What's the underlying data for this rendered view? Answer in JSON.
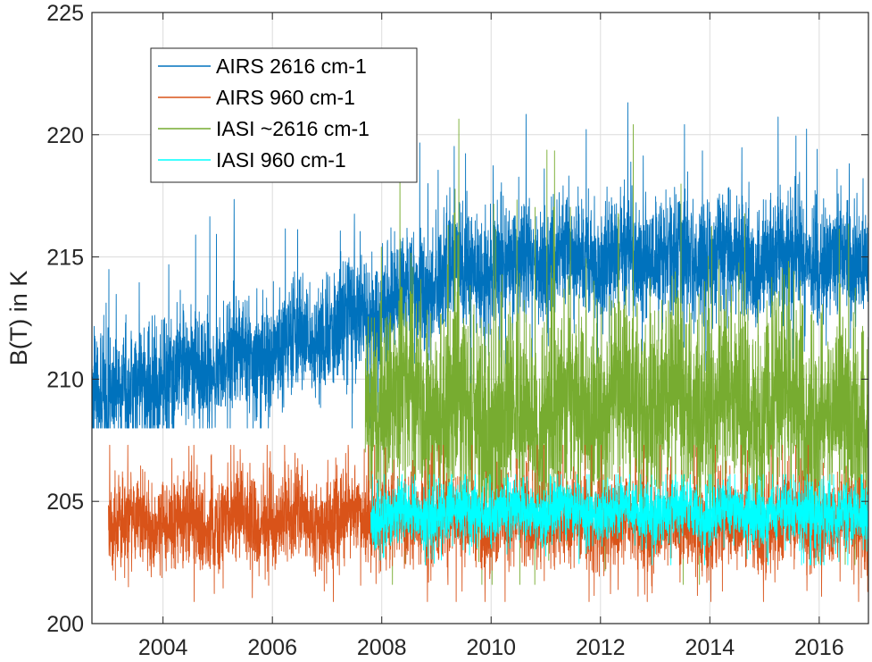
{
  "chart_data": {
    "type": "line",
    "title": "",
    "xlabel": "",
    "ylabel": "B(T) in K",
    "xlim": [
      2002.7,
      2016.9
    ],
    "ylim": [
      200,
      225
    ],
    "grid": true,
    "legend_position": "top-left",
    "x_ticks": [
      {
        "value": 2004,
        "label": "2004"
      },
      {
        "value": 2006,
        "label": "2006"
      },
      {
        "value": 2008,
        "label": "2008"
      },
      {
        "value": 2010,
        "label": "2010"
      },
      {
        "value": 2012,
        "label": "2012"
      },
      {
        "value": 2014,
        "label": "2014"
      },
      {
        "value": 2016,
        "label": "2016"
      }
    ],
    "y_ticks": [
      {
        "value": 200,
        "label": "200"
      },
      {
        "value": 205,
        "label": "205"
      },
      {
        "value": 210,
        "label": "210"
      },
      {
        "value": 215,
        "label": "215"
      },
      {
        "value": 220,
        "label": "220"
      },
      {
        "value": 225,
        "label": "225"
      }
    ],
    "series": [
      {
        "name": "AIRS 2616 cm-1",
        "color": "#0072BD",
        "x_range": [
          2002.7,
          2016.9
        ],
        "mean_trend": [
          {
            "x": 2002.7,
            "y": 209.6
          },
          {
            "x": 2003.5,
            "y": 209.4
          },
          {
            "x": 2004.0,
            "y": 209.8
          },
          {
            "x": 2005.0,
            "y": 210.6
          },
          {
            "x": 2006.0,
            "y": 211.2
          },
          {
            "x": 2007.0,
            "y": 212.0
          },
          {
            "x": 2008.0,
            "y": 213.0
          },
          {
            "x": 2009.0,
            "y": 214.2
          },
          {
            "x": 2010.0,
            "y": 214.6
          },
          {
            "x": 2012.0,
            "y": 215.0
          },
          {
            "x": 2014.0,
            "y": 215.0
          },
          {
            "x": 2016.9,
            "y": 214.8
          }
        ],
        "noise_amplitude": 1.2,
        "min_observed": 208.0,
        "max_observed": 221.6
      },
      {
        "name": "AIRS 960 cm-1",
        "color": "#D95319",
        "x_range": [
          2003.0,
          2016.9
        ],
        "mean_trend": [
          {
            "x": 2003.0,
            "y": 204.1
          },
          {
            "x": 2008.0,
            "y": 204.3
          },
          {
            "x": 2012.0,
            "y": 204.1
          },
          {
            "x": 2016.9,
            "y": 204.0
          }
        ],
        "noise_amplitude": 0.9,
        "min_observed": 200.9,
        "max_observed": 207.3
      },
      {
        "name": "IASI ~2616 cm-1",
        "color": "#77AC30",
        "x_range": [
          2007.7,
          2016.9
        ],
        "mean_trend": [
          {
            "x": 2007.7,
            "y": 209.5
          },
          {
            "x": 2010.0,
            "y": 208.4
          },
          {
            "x": 2012.0,
            "y": 209.0
          },
          {
            "x": 2014.0,
            "y": 209.2
          },
          {
            "x": 2016.9,
            "y": 208.3
          }
        ],
        "noise_amplitude": 2.0,
        "min_observed": 201.6,
        "max_observed": 221.1
      },
      {
        "name": "IASI 960 cm-1",
        "color": "#00FFFF",
        "x_range": [
          2007.8,
          2016.9
        ],
        "mean_trend": [
          {
            "x": 2007.8,
            "y": 204.4
          },
          {
            "x": 2012.0,
            "y": 204.6
          },
          {
            "x": 2016.9,
            "y": 204.5
          }
        ],
        "noise_amplitude": 0.6,
        "min_observed": 202.4,
        "max_observed": 206.1
      }
    ]
  }
}
